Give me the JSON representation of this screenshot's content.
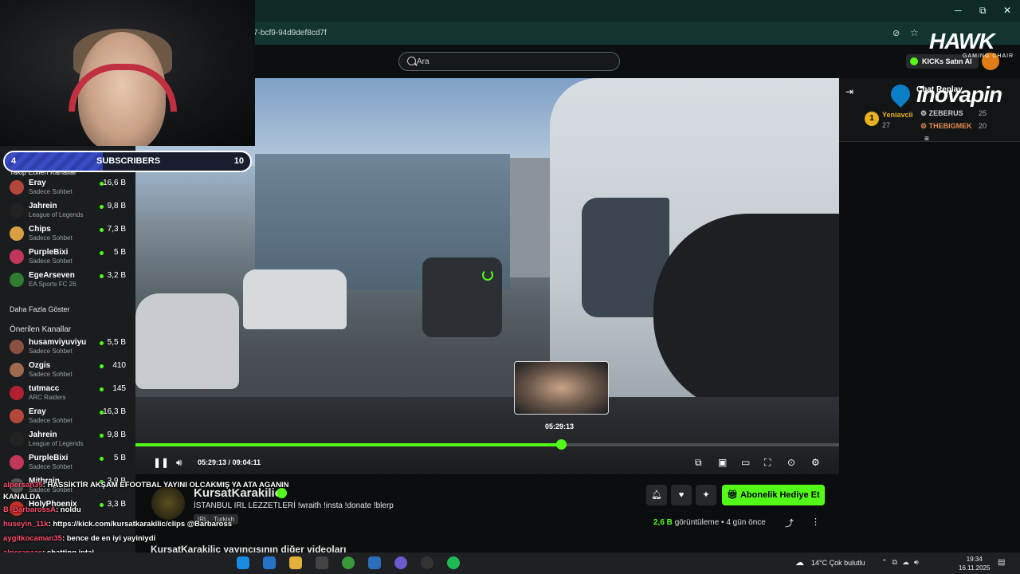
{
  "browser": {
    "address": "7-bcf9-94d9def8cd7f",
    "min_label": "─",
    "max_label": "⧉",
    "close_label": "✕"
  },
  "header": {
    "search_placeholder": "Ara",
    "kicks_label": "KICKs Satın Al"
  },
  "overlay": {
    "hawk": "HAWK",
    "hawk_sub": "GAMING CHAIR",
    "inova": "inovapin",
    "subscribers": {
      "left": "4",
      "label": "SUBSCRIBERS",
      "right": "10",
      "progress": 0.4
    }
  },
  "sidebar": {
    "followed_heading": "Takip Edilen Kanallar",
    "followed": [
      {
        "name": "Eray",
        "category": "Sadece Sohbet",
        "viewers": "16,6 B",
        "color": "#b5473a"
      },
      {
        "name": "Jahrein",
        "category": "League of Legends",
        "viewers": "9,8 B",
        "color": "#222"
      },
      {
        "name": "Chips",
        "category": "Sadece Sohbet",
        "viewers": "7,3 B",
        "color": "#d8a040"
      },
      {
        "name": "PurpleBixi",
        "category": "Sadece Sohbet",
        "viewers": "5 B",
        "color": "#c2365a"
      },
      {
        "name": "EgeArseven",
        "category": "EA Sports FC 26",
        "viewers": "3,2 B",
        "color": "#2e7d32"
      }
    ],
    "show_more": "Daha Fazla Göster",
    "recommended_heading": "Önerilen Kanallar",
    "recommended": [
      {
        "name": "husamviyuviyu",
        "category": "Sadece Sohbet",
        "viewers": "5,5 B",
        "color": "#8a5040"
      },
      {
        "name": "Ozgis",
        "category": "Sadece Sohbet",
        "viewers": "410",
        "color": "#a06a50"
      },
      {
        "name": "tutmacc",
        "category": "ARC Raiders",
        "viewers": "145",
        "color": "#b02030"
      },
      {
        "name": "Eray",
        "category": "Sadece Sohbet",
        "viewers": "16,3 B",
        "color": "#b5473a"
      },
      {
        "name": "Jahrein",
        "category": "League of Legends",
        "viewers": "9,8 B",
        "color": "#222"
      },
      {
        "name": "PurpleBixi",
        "category": "Sadece Sohbet",
        "viewers": "5 B",
        "color": "#c2365a"
      },
      {
        "name": "Mithrain",
        "category": "Sadece Sohbet",
        "viewers": "3,9 B",
        "color": "#555"
      },
      {
        "name": "HolyPhoenix",
        "category": "",
        "viewers": "3,3 B",
        "color": "#c83020"
      }
    ]
  },
  "video": {
    "preview_time": "05:29:13",
    "current_time": "05:29:13",
    "separator": "/",
    "duration": "09:04:11",
    "progress": 0.605
  },
  "chat": {
    "replay_title": "Chat Replay",
    "leaderboard": [
      {
        "rank": "1",
        "name": "Yeniavcii",
        "count": "27",
        "color": "#e8b020"
      },
      {
        "name": "ZEBERUS",
        "count": "25",
        "color": "#cccccc"
      },
      {
        "name": "THEBIGMEK",
        "count": "20",
        "color": "#e08a50"
      }
    ]
  },
  "stream_info": {
    "channel_name": "KursatKarakilic",
    "title": "İSTANBUL IRL LEZZETLERİ !wraith !insta !donate !blerp",
    "tags": [
      "IRL",
      "Turkish"
    ],
    "gift_label": "Abonelik Hediye Et",
    "views": "2,6 B",
    "views_label": "görüntüleme",
    "ago": "4 gün önce",
    "other_videos": "KursatKarakilic yayıncısının diğer videoları"
  },
  "chat_overlay": [
    {
      "user": "alpersan35",
      "text": ": HASSİKTİR AKŞAM EFOOTBAL YAYINI OLCAKMIŞ YA ATA AGANIN"
    },
    {
      "user": "",
      "text": "KANALDA"
    },
    {
      "user": "B_BarbarossA",
      "text": ": noldu"
    },
    {
      "user": "huseyin_11k",
      "text": ": https://kick.com/kursatkarakilic/clips @Barbaross"
    },
    {
      "user": "aygitkocaman35",
      "text": ": bence de en iyi yayiniydi"
    },
    {
      "user": "alperanaze",
      "text": ": chatting iptal"
    },
    {
      "user": "huseyin_11k",
      "text": ": https://kick.com/kursatkarakilic/clips @Barbaross"
    }
  ],
  "taskbar": {
    "weather": "14°C  Çok bulutlu",
    "time": "19:34",
    "date": "16.11.2025"
  },
  "colors": {
    "accent": "#53fc18",
    "chat_user": "#ff4d6d"
  }
}
